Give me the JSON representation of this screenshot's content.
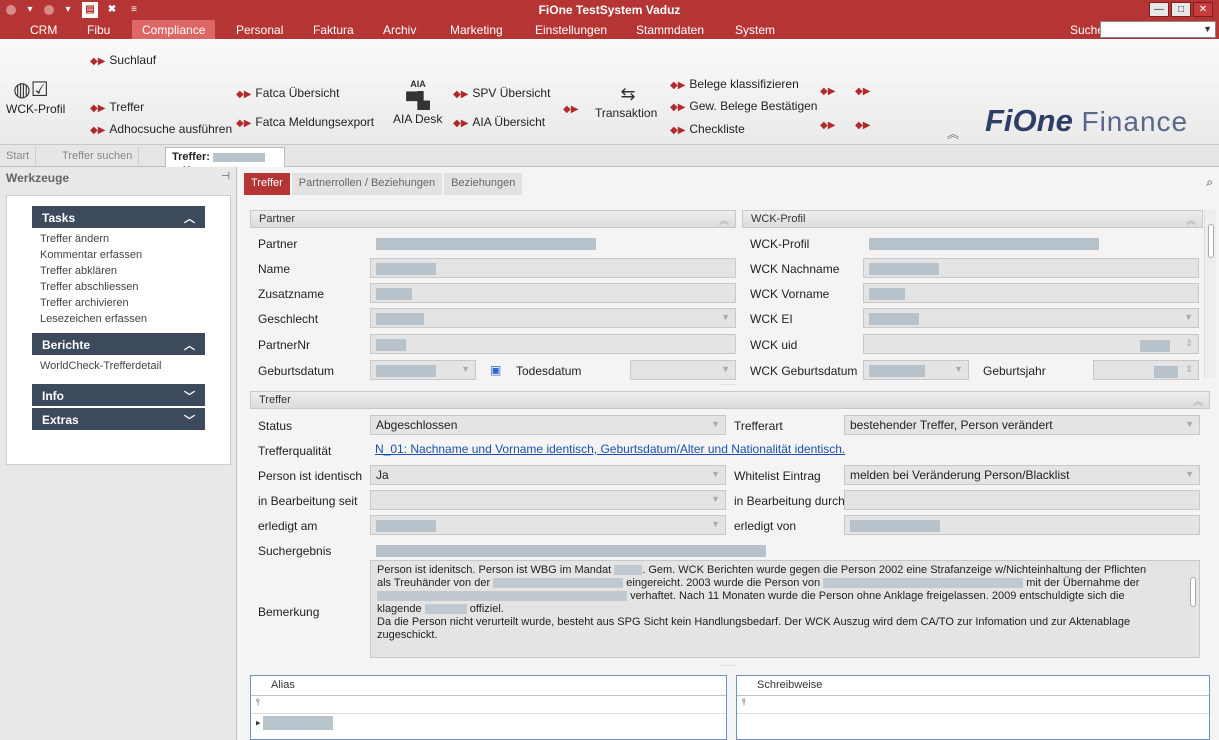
{
  "window": {
    "title": "FiOne TestSystem Vaduz"
  },
  "menu": {
    "items": [
      "CRM",
      "Fibu",
      "Compliance",
      "Personal",
      "Faktura",
      "Archiv",
      "Marketing",
      "Einstellungen",
      "Stammdaten",
      "System"
    ],
    "active": "Compliance",
    "search_label": "Suchen"
  },
  "ribbon": {
    "wck_profil": "WCK-Profil",
    "suchlauf": "Suchlauf",
    "treffer": "Treffer",
    "adhoc": "Adhocsuche ausführen",
    "fatca_uebersicht": "Fatca Übersicht",
    "fatca_export": "Fatca Meldungsexport",
    "aia_desk": "AIA Desk",
    "aia_logo": "AIA",
    "spv_uebersicht": "SPV Übersicht",
    "aia_uebersicht": "AIA Übersicht",
    "transaktion": "Transaktion",
    "belege_klass": "Belege klassifizieren",
    "gew_belege": "Gew. Belege Bestätigen",
    "checkliste": "Checkliste",
    "brand_bold": "FiOne",
    "brand_light": "Finance"
  },
  "doctabs": {
    "start": "Start",
    "treffer_suchen": "Treffer suchen",
    "treffer_active": "Treffer:"
  },
  "leftpanel": {
    "title": "Werkzeuge",
    "tasks": {
      "title": "Tasks",
      "items": [
        "Treffer ändern",
        "Kommentar erfassen",
        "Treffer abklären",
        "Treffer abschliessen",
        "Treffer archivieren",
        "Lesezeichen erfassen"
      ]
    },
    "berichte": {
      "title": "Berichte",
      "items": [
        "WorldCheck-Trefferdetail"
      ]
    },
    "info": {
      "title": "Info"
    },
    "extras": {
      "title": "Extras"
    }
  },
  "subtabs": [
    "Treffer",
    "Partnerrollen / Beziehungen",
    "Beziehungen"
  ],
  "partner": {
    "header": "Partner",
    "labels": {
      "partner": "Partner",
      "name": "Name",
      "zusatzname": "Zusatzname",
      "geschlecht": "Geschlecht",
      "partnernr": "PartnerNr",
      "geburtsdatum": "Geburtsdatum",
      "todesdatum": "Todesdatum"
    }
  },
  "wck": {
    "header": "WCK-Profil",
    "labels": {
      "profil": "WCK-Profil",
      "nachname": "WCK Nachname",
      "vorname": "WCK Vorname",
      "ei": "WCK EI",
      "uid": "WCK uid",
      "geburtsdatum": "WCK Geburtsdatum",
      "geburtsjahr": "Geburtsjahr"
    }
  },
  "treffer": {
    "header": "Treffer",
    "labels": {
      "status": "Status",
      "trefferart": "Trefferart",
      "qualitaet": "Trefferqualität",
      "identisch": "Person ist identisch",
      "whitelist": "Whitelist Eintrag",
      "bearbeitung_seit": "in Bearbeitung seit",
      "bearbeitung_durch": "in Bearbeitung durch",
      "erledigt_am": "erledigt am",
      "erledigt_von": "erledigt von",
      "suchergebnis": "Suchergebnis",
      "bemerkung": "Bemerkung"
    },
    "values": {
      "status": "Abgeschlossen",
      "trefferart": "bestehender Treffer, Person verändert",
      "qualitaet": "N_01: Nachname und Vorname identisch, Geburtsdatum/Alter und Nationalität identisch.",
      "identisch": "Ja",
      "whitelist": "melden bei Veränderung Person/Blacklist"
    },
    "bemerkung": {
      "l1a": "Person ist idenitsch. Person ist WBG im Mandat",
      "l1b": ". Gem. WCK Berichten wurde gegen die Person 2002 eine Strafanzeige w/Nichteinhaltung der Pflichten",
      "l2a": "als Treuhänder von der",
      "l2b": "eingereicht. 2003 wurde die Person von",
      "l2c": "mit der Übernahme der",
      "l3a": "verhaftet. Nach 11 Monaten wurde die Person ohne Anklage freigelassen. 2009 entschuldigte sich die",
      "l4a": "klagende",
      "l4b": "offiziel.",
      "l5": "Da die Person nicht verurteilt wurde, besteht aus SPG Sicht kein Handlungsbedarf. Der WCK Auszug wird dem CA/TO zur Infomation und zur Aktenablage",
      "l6": "zugeschickt."
    }
  },
  "grids": {
    "alias": "Alias",
    "schreibweise": "Schreibweise"
  }
}
